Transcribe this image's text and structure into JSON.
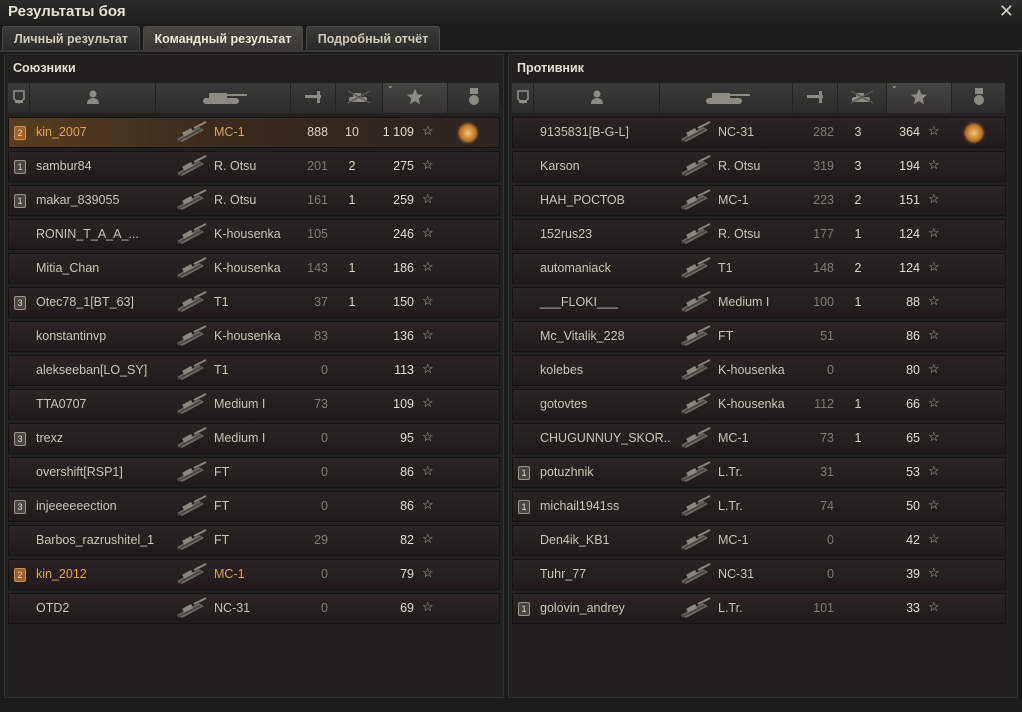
{
  "window": {
    "title": "Результаты боя"
  },
  "tabs": [
    {
      "label": "Личный результат",
      "active": false
    },
    {
      "label": "Командный результат",
      "active": true
    },
    {
      "label": "Подробный отчёт",
      "active": false
    }
  ],
  "header_icons": [
    "shield-icon",
    "player-icon",
    "tank-icon",
    "damage-icon",
    "frags-icon",
    "star-icon",
    "medal-icon"
  ],
  "colors": {
    "player_highlight": "#e0a644",
    "row_bg": "#2b2423",
    "panel_bg": "#232120"
  },
  "allies": {
    "title": "Союзники",
    "rows": [
      {
        "badge": "2",
        "name": "kin_2007",
        "tank": "MC-1",
        "damage": "888",
        "frags": "10",
        "xp": "1 109",
        "medal": true,
        "player": true
      },
      {
        "badge": "1",
        "name": "sambur84",
        "tank": "R. Otsu",
        "damage": "201",
        "frags": "2",
        "xp": "275"
      },
      {
        "badge": "1",
        "name": "makar_839055",
        "tank": "R. Otsu",
        "damage": "161",
        "frags": "1",
        "xp": "259"
      },
      {
        "badge": "",
        "name": "RONIN_T_A_A_...",
        "tank": "K-housenka",
        "damage": "105",
        "frags": "",
        "xp": "246"
      },
      {
        "badge": "",
        "name": "Mitia_Chan",
        "tank": "K-housenka",
        "damage": "143",
        "frags": "1",
        "xp": "186"
      },
      {
        "badge": "3",
        "name": "Otec78_1[BT_63]",
        "tank": "T1",
        "damage": "37",
        "frags": "1",
        "xp": "150"
      },
      {
        "badge": "",
        "name": "konstantinvp",
        "tank": "K-housenka",
        "damage": "83",
        "frags": "",
        "xp": "136"
      },
      {
        "badge": "",
        "name": "alekseeban[LO_SY]",
        "tank": "T1",
        "damage": "0",
        "frags": "",
        "xp": "113"
      },
      {
        "badge": "",
        "name": "TTA0707",
        "tank": "Medium I",
        "damage": "73",
        "frags": "",
        "xp": "109"
      },
      {
        "badge": "3",
        "name": "trexz",
        "tank": "Medium I",
        "damage": "0",
        "frags": "",
        "xp": "95"
      },
      {
        "badge": "",
        "name": "overshift[RSP1]",
        "tank": "FT",
        "damage": "0",
        "frags": "",
        "xp": "86"
      },
      {
        "badge": "3",
        "name": "injeeeeeection",
        "tank": "FT",
        "damage": "0",
        "frags": "",
        "xp": "86"
      },
      {
        "badge": "",
        "name": "Barbos_razrushitel_1",
        "tank": "FT",
        "damage": "29",
        "frags": "",
        "xp": "82"
      },
      {
        "badge": "2",
        "name": "kin_2012",
        "tank": "MC-1",
        "damage": "0",
        "frags": "",
        "xp": "79",
        "orange": true
      },
      {
        "badge": "",
        "name": "OTD2",
        "tank": "NC-31",
        "damage": "0",
        "frags": "",
        "xp": "69"
      }
    ]
  },
  "enemies": {
    "title": "Противник",
    "rows": [
      {
        "badge": "",
        "name": "9135831[B-G-L]",
        "tank": "NC-31",
        "damage": "282",
        "frags": "3",
        "xp": "364",
        "medal": true
      },
      {
        "badge": "",
        "name": "Karson",
        "tank": "R. Otsu",
        "damage": "319",
        "frags": "3",
        "xp": "194"
      },
      {
        "badge": "",
        "name": "НАН_РОСТОВ",
        "tank": "MC-1",
        "damage": "223",
        "frags": "2",
        "xp": "151"
      },
      {
        "badge": "",
        "name": "152rus23",
        "tank": "R. Otsu",
        "damage": "177",
        "frags": "1",
        "xp": "124"
      },
      {
        "badge": "",
        "name": "automaniack",
        "tank": "T1",
        "damage": "148",
        "frags": "2",
        "xp": "124"
      },
      {
        "badge": "",
        "name": "___FLOKI___",
        "tank": "Medium I",
        "damage": "100",
        "frags": "1",
        "xp": "88"
      },
      {
        "badge": "",
        "name": "Mc_Vitalik_228",
        "tank": "FT",
        "damage": "51",
        "frags": "",
        "xp": "86"
      },
      {
        "badge": "",
        "name": "kolebes",
        "tank": "K-housenka",
        "damage": "0",
        "frags": "",
        "xp": "80"
      },
      {
        "badge": "",
        "name": "gotovtes",
        "tank": "K-housenka",
        "damage": "112",
        "frags": "1",
        "xp": "66"
      },
      {
        "badge": "",
        "name": "CHUGUNNUY_SKOR..",
        "tank": "MC-1",
        "damage": "73",
        "frags": "1",
        "xp": "65"
      },
      {
        "badge": "1",
        "name": "potuzhnik",
        "tank": "L.Tr.",
        "damage": "31",
        "frags": "",
        "xp": "53"
      },
      {
        "badge": "1",
        "name": "michail1941ss",
        "tank": "L.Tr.",
        "damage": "74",
        "frags": "",
        "xp": "50"
      },
      {
        "badge": "",
        "name": "Den4ik_KB1",
        "tank": "MC-1",
        "damage": "0",
        "frags": "",
        "xp": "42"
      },
      {
        "badge": "",
        "name": "Tuhr_77",
        "tank": "NC-31",
        "damage": "0",
        "frags": "",
        "xp": "39"
      },
      {
        "badge": "1",
        "name": "golovin_andrey",
        "tank": "L.Tr.",
        "damage": "101",
        "frags": "",
        "xp": "33"
      }
    ]
  }
}
